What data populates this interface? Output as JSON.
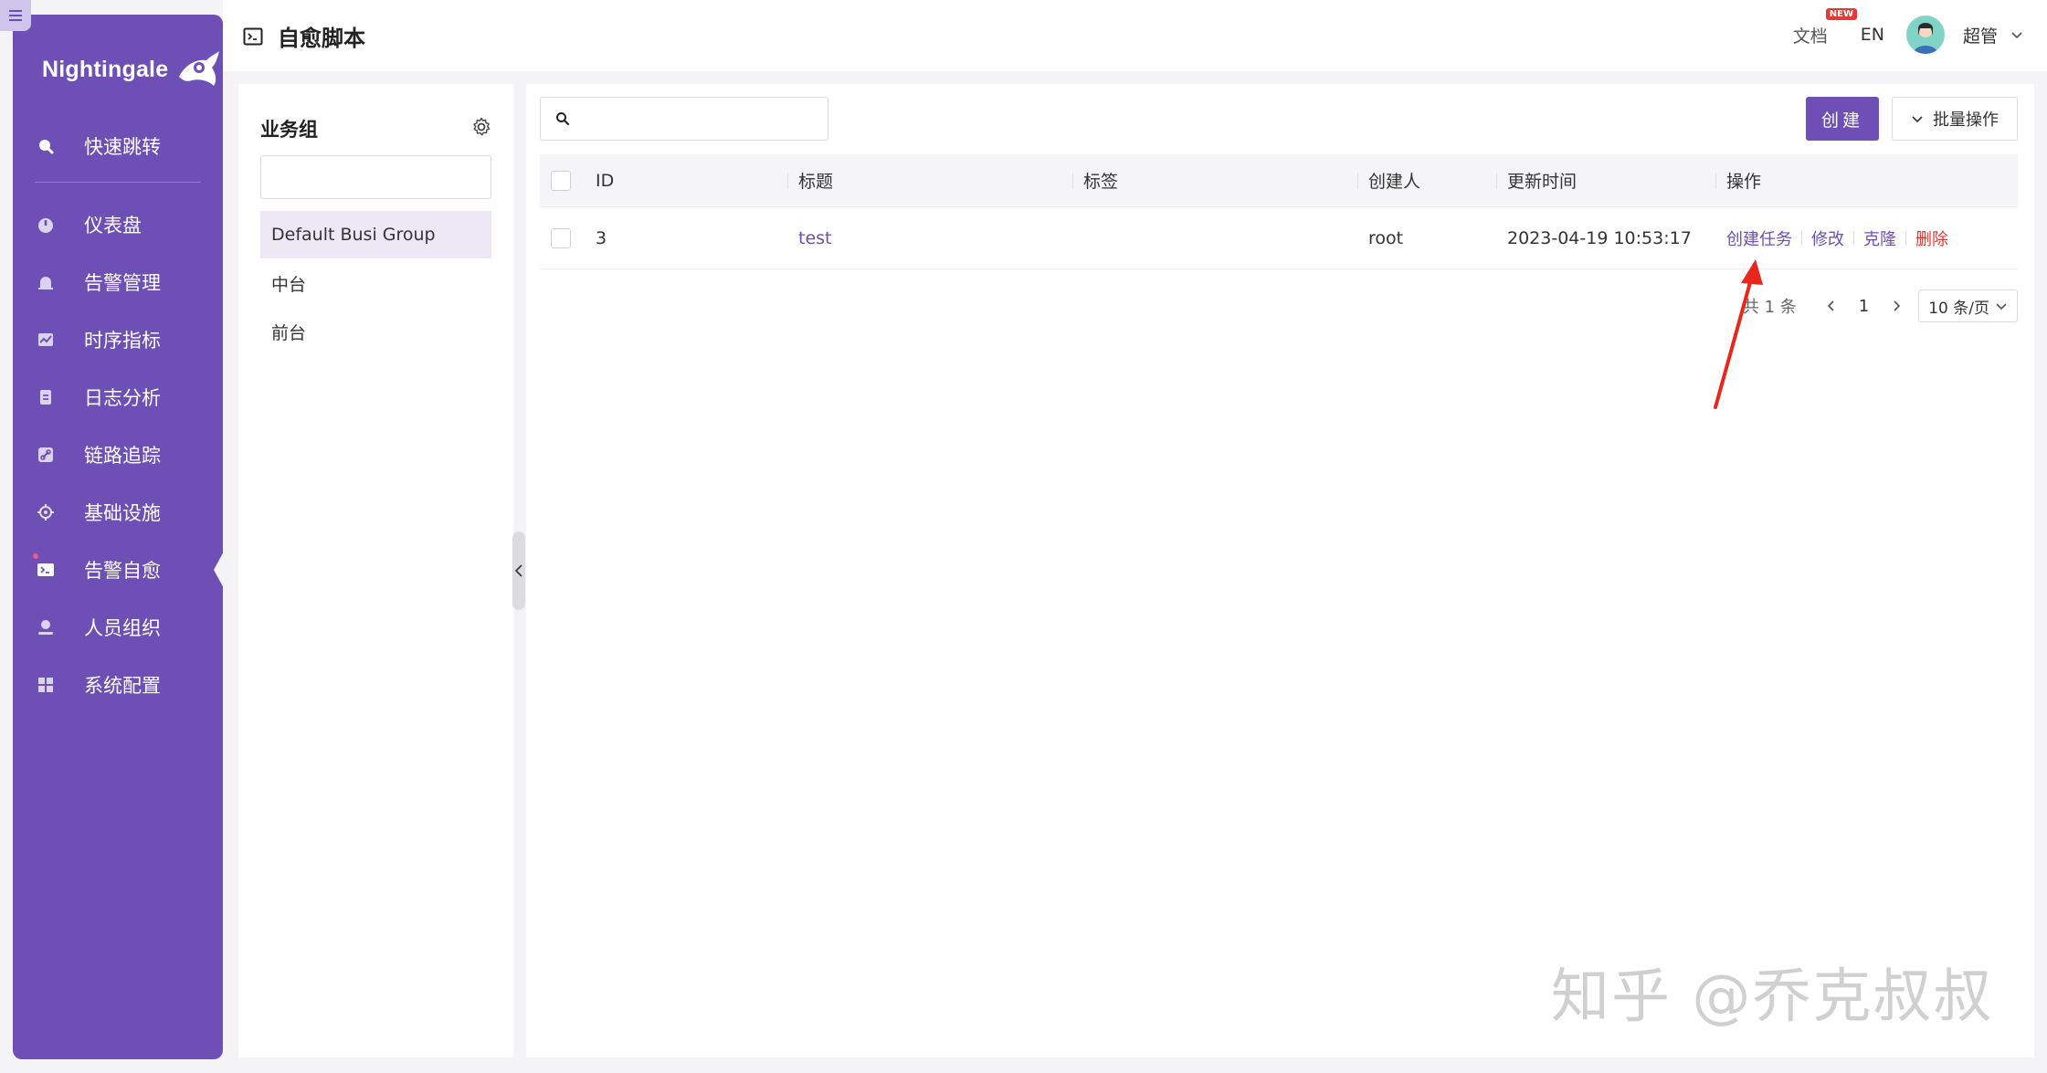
{
  "app": {
    "logo_text": "Nightingale"
  },
  "sidebar": {
    "items": [
      {
        "label": "快速跳转",
        "icon": "search-icon"
      },
      {
        "label": "仪表盘",
        "icon": "dashboard-icon"
      },
      {
        "label": "告警管理",
        "icon": "alarm-icon"
      },
      {
        "label": "时序指标",
        "icon": "chart-icon"
      },
      {
        "label": "日志分析",
        "icon": "log-icon"
      },
      {
        "label": "链路追踪",
        "icon": "link-icon"
      },
      {
        "label": "基础设施",
        "icon": "target-icon"
      },
      {
        "label": "告警自愈",
        "icon": "terminal-icon",
        "active": true
      },
      {
        "label": "人员组织",
        "icon": "user-icon"
      },
      {
        "label": "系统配置",
        "icon": "grid-icon"
      }
    ]
  },
  "header": {
    "title": "自愈脚本",
    "doc_label": "文档",
    "doc_badge": "NEW",
    "lang": "EN",
    "user_name": "超管"
  },
  "groups": {
    "title": "业务组",
    "search_value": "",
    "items": [
      "Default Busi Group",
      "中台",
      "前台"
    ],
    "selected": "Default Busi Group"
  },
  "main": {
    "search_value": "",
    "create_label": "创建",
    "batch_label": "批量操作",
    "columns": {
      "id": "ID",
      "title": "标题",
      "tags": "标签",
      "creator": "创建人",
      "updated": "更新时间",
      "ops": "操作"
    },
    "rows": [
      {
        "id": "3",
        "title": "test",
        "tags": "",
        "creator": "root",
        "updated": "2023-04-19 10:53:17",
        "ops": {
          "create_task": "创建任务",
          "edit": "修改",
          "clone": "克隆",
          "delete": "删除"
        }
      }
    ],
    "pagination": {
      "total": "共 1 条",
      "current": "1",
      "page_size": "10 条/页"
    }
  },
  "colors": {
    "brand": "#6e4fb6",
    "danger": "#e53935",
    "annotation": "#e8261c"
  },
  "watermark": "知乎 @乔克叔叔"
}
